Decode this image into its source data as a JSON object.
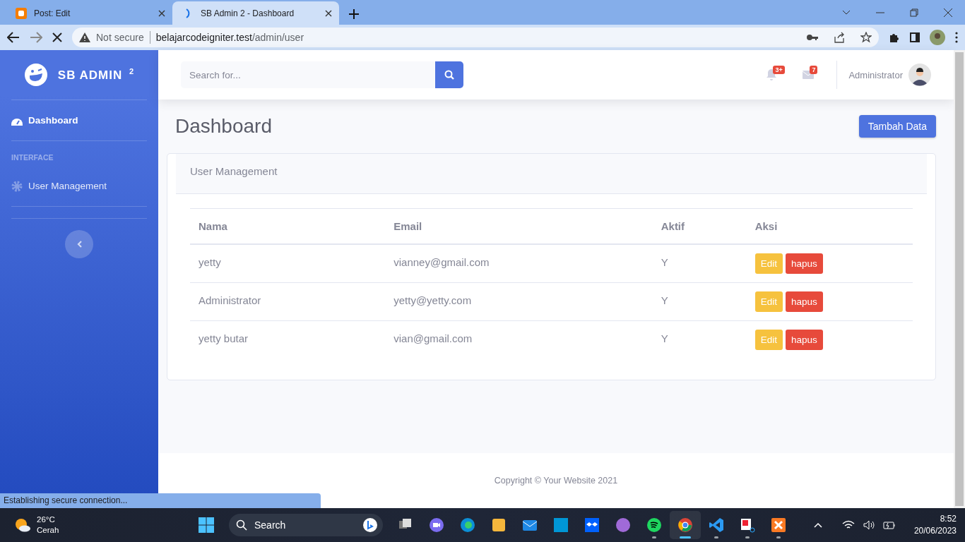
{
  "browser": {
    "tabs": [
      {
        "title": "Post: Edit",
        "selected": false
      },
      {
        "title": "SB Admin 2 - Dashboard",
        "selected": true
      }
    ],
    "loading": true,
    "security": "Not secure",
    "host": "belajarcodeigniter.test",
    "path": "/admin/user"
  },
  "sidebar": {
    "brand": "SB ADMIN $^{2}$",
    "items": [
      {
        "kind": "link",
        "label": "Dashboard",
        "selected": true
      },
      {
        "kind": "heading",
        "label": "INTERFACE"
      },
      {
        "kind": "link",
        "label": "User Management",
        "selected": false
      }
    ]
  },
  "topbar": {
    "search": {
      "placeholder": "Search for..."
    },
    "alerts_badge": "3+",
    "messages_badge": "7",
    "user": "Administrator"
  },
  "page": {
    "title": "Dashboard",
    "add_button": "Tambah Data"
  },
  "card": {
    "title": "User Management",
    "columns": [
      "Nama",
      "Email",
      "Aktif",
      "Aksi"
    ],
    "rows": [
      {
        "cells": [
          "yetty",
          "vianney@gmail.com",
          "Y"
        ],
        "actions": [
          "Edit",
          "hapus"
        ]
      },
      {
        "cells": [
          "Administrator",
          "yetty@yetty.com",
          "Y"
        ],
        "actions": [
          "Edit",
          "hapus"
        ]
      },
      {
        "cells": [
          "yetty butar",
          "vian@gmail.com",
          "Y"
        ],
        "actions": [
          "Edit",
          "hapus"
        ]
      }
    ]
  },
  "footer": "Copyright © Your Website 2021",
  "status_bubble": "Establishing secure connection...",
  "taskbar": {
    "temperature": "26°C",
    "condition": "Cerah",
    "search": "Search",
    "apps": [
      {
        "running": false,
        "selected": false
      },
      {
        "running": false,
        "selected": false
      },
      {
        "running": false,
        "selected": false
      },
      {
        "running": false,
        "selected": false
      },
      {
        "running": false,
        "selected": false
      },
      {
        "running": false,
        "selected": false
      },
      {
        "running": false,
        "selected": false
      },
      {
        "running": false,
        "selected": false
      },
      {
        "running": true,
        "selected": false
      },
      {
        "running": true,
        "selected": true
      },
      {
        "running": true,
        "selected": false
      },
      {
        "running": true,
        "selected": false
      },
      {
        "running": true,
        "selected": false
      }
    ],
    "time": "8:52",
    "date": "20/06/2023"
  }
}
